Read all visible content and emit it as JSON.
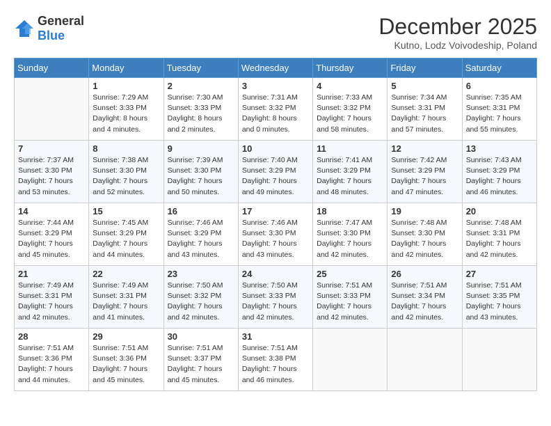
{
  "logo": {
    "general": "General",
    "blue": "Blue"
  },
  "title": "December 2025",
  "location": "Kutno, Lodz Voivodeship, Poland",
  "days_of_week": [
    "Sunday",
    "Monday",
    "Tuesday",
    "Wednesday",
    "Thursday",
    "Friday",
    "Saturday"
  ],
  "weeks": [
    [
      {
        "num": "",
        "info": ""
      },
      {
        "num": "1",
        "info": "Sunrise: 7:29 AM\nSunset: 3:33 PM\nDaylight: 8 hours\nand 4 minutes."
      },
      {
        "num": "2",
        "info": "Sunrise: 7:30 AM\nSunset: 3:33 PM\nDaylight: 8 hours\nand 2 minutes."
      },
      {
        "num": "3",
        "info": "Sunrise: 7:31 AM\nSunset: 3:32 PM\nDaylight: 8 hours\nand 0 minutes."
      },
      {
        "num": "4",
        "info": "Sunrise: 7:33 AM\nSunset: 3:32 PM\nDaylight: 7 hours\nand 58 minutes."
      },
      {
        "num": "5",
        "info": "Sunrise: 7:34 AM\nSunset: 3:31 PM\nDaylight: 7 hours\nand 57 minutes."
      },
      {
        "num": "6",
        "info": "Sunrise: 7:35 AM\nSunset: 3:31 PM\nDaylight: 7 hours\nand 55 minutes."
      }
    ],
    [
      {
        "num": "7",
        "info": "Sunrise: 7:37 AM\nSunset: 3:30 PM\nDaylight: 7 hours\nand 53 minutes."
      },
      {
        "num": "8",
        "info": "Sunrise: 7:38 AM\nSunset: 3:30 PM\nDaylight: 7 hours\nand 52 minutes."
      },
      {
        "num": "9",
        "info": "Sunrise: 7:39 AM\nSunset: 3:30 PM\nDaylight: 7 hours\nand 50 minutes."
      },
      {
        "num": "10",
        "info": "Sunrise: 7:40 AM\nSunset: 3:29 PM\nDaylight: 7 hours\nand 49 minutes."
      },
      {
        "num": "11",
        "info": "Sunrise: 7:41 AM\nSunset: 3:29 PM\nDaylight: 7 hours\nand 48 minutes."
      },
      {
        "num": "12",
        "info": "Sunrise: 7:42 AM\nSunset: 3:29 PM\nDaylight: 7 hours\nand 47 minutes."
      },
      {
        "num": "13",
        "info": "Sunrise: 7:43 AM\nSunset: 3:29 PM\nDaylight: 7 hours\nand 46 minutes."
      }
    ],
    [
      {
        "num": "14",
        "info": "Sunrise: 7:44 AM\nSunset: 3:29 PM\nDaylight: 7 hours\nand 45 minutes."
      },
      {
        "num": "15",
        "info": "Sunrise: 7:45 AM\nSunset: 3:29 PM\nDaylight: 7 hours\nand 44 minutes."
      },
      {
        "num": "16",
        "info": "Sunrise: 7:46 AM\nSunset: 3:29 PM\nDaylight: 7 hours\nand 43 minutes."
      },
      {
        "num": "17",
        "info": "Sunrise: 7:46 AM\nSunset: 3:30 PM\nDaylight: 7 hours\nand 43 minutes."
      },
      {
        "num": "18",
        "info": "Sunrise: 7:47 AM\nSunset: 3:30 PM\nDaylight: 7 hours\nand 42 minutes."
      },
      {
        "num": "19",
        "info": "Sunrise: 7:48 AM\nSunset: 3:30 PM\nDaylight: 7 hours\nand 42 minutes."
      },
      {
        "num": "20",
        "info": "Sunrise: 7:48 AM\nSunset: 3:31 PM\nDaylight: 7 hours\nand 42 minutes."
      }
    ],
    [
      {
        "num": "21",
        "info": "Sunrise: 7:49 AM\nSunset: 3:31 PM\nDaylight: 7 hours\nand 42 minutes."
      },
      {
        "num": "22",
        "info": "Sunrise: 7:49 AM\nSunset: 3:31 PM\nDaylight: 7 hours\nand 41 minutes."
      },
      {
        "num": "23",
        "info": "Sunrise: 7:50 AM\nSunset: 3:32 PM\nDaylight: 7 hours\nand 42 minutes."
      },
      {
        "num": "24",
        "info": "Sunrise: 7:50 AM\nSunset: 3:33 PM\nDaylight: 7 hours\nand 42 minutes."
      },
      {
        "num": "25",
        "info": "Sunrise: 7:51 AM\nSunset: 3:33 PM\nDaylight: 7 hours\nand 42 minutes."
      },
      {
        "num": "26",
        "info": "Sunrise: 7:51 AM\nSunset: 3:34 PM\nDaylight: 7 hours\nand 42 minutes."
      },
      {
        "num": "27",
        "info": "Sunrise: 7:51 AM\nSunset: 3:35 PM\nDaylight: 7 hours\nand 43 minutes."
      }
    ],
    [
      {
        "num": "28",
        "info": "Sunrise: 7:51 AM\nSunset: 3:36 PM\nDaylight: 7 hours\nand 44 minutes."
      },
      {
        "num": "29",
        "info": "Sunrise: 7:51 AM\nSunset: 3:36 PM\nDaylight: 7 hours\nand 45 minutes."
      },
      {
        "num": "30",
        "info": "Sunrise: 7:51 AM\nSunset: 3:37 PM\nDaylight: 7 hours\nand 45 minutes."
      },
      {
        "num": "31",
        "info": "Sunrise: 7:51 AM\nSunset: 3:38 PM\nDaylight: 7 hours\nand 46 minutes."
      },
      {
        "num": "",
        "info": ""
      },
      {
        "num": "",
        "info": ""
      },
      {
        "num": "",
        "info": ""
      }
    ]
  ]
}
